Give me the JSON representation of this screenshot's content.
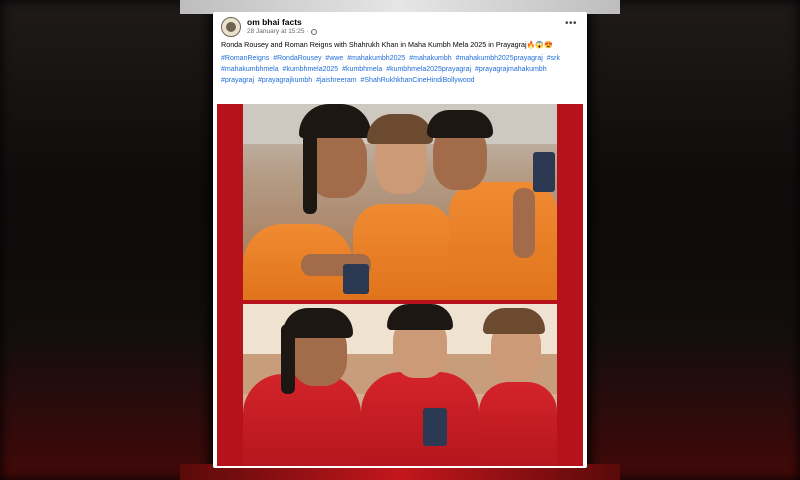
{
  "post": {
    "page_name": "om bhai facts",
    "date": "28 January at 15:25 ·",
    "more_icon": "more-horizontal-icon",
    "caption": "Ronda Rousey and Roman Reigns with Shahrukh Khan in Maha Kumbh Mela 2025 in Prayagraj",
    "caption_emojis": "🔥😱😍",
    "hashtags": [
      "#RomanReigns",
      "#RondaRousey",
      "#wwe",
      "#mahakumbh2025",
      "#mahakumbh",
      "#mahakumbh2025prayagraj",
      "#srk",
      "#mahakumbhmela",
      "#kumbhmela2025",
      "#kumbhmela",
      "#kumbhmela2025prayagraj",
      "#prayagrajmahakumbh",
      "#prayagraj",
      "#prayagrajkumbh",
      "#jaishreeram",
      "#ShahRukhkhanCineHindiBollywood"
    ]
  },
  "colors": {
    "link": "#216fdb",
    "frame_red": "#b5121b",
    "robe_orange": "#f08b32",
    "robe_red": "#d4242a"
  }
}
